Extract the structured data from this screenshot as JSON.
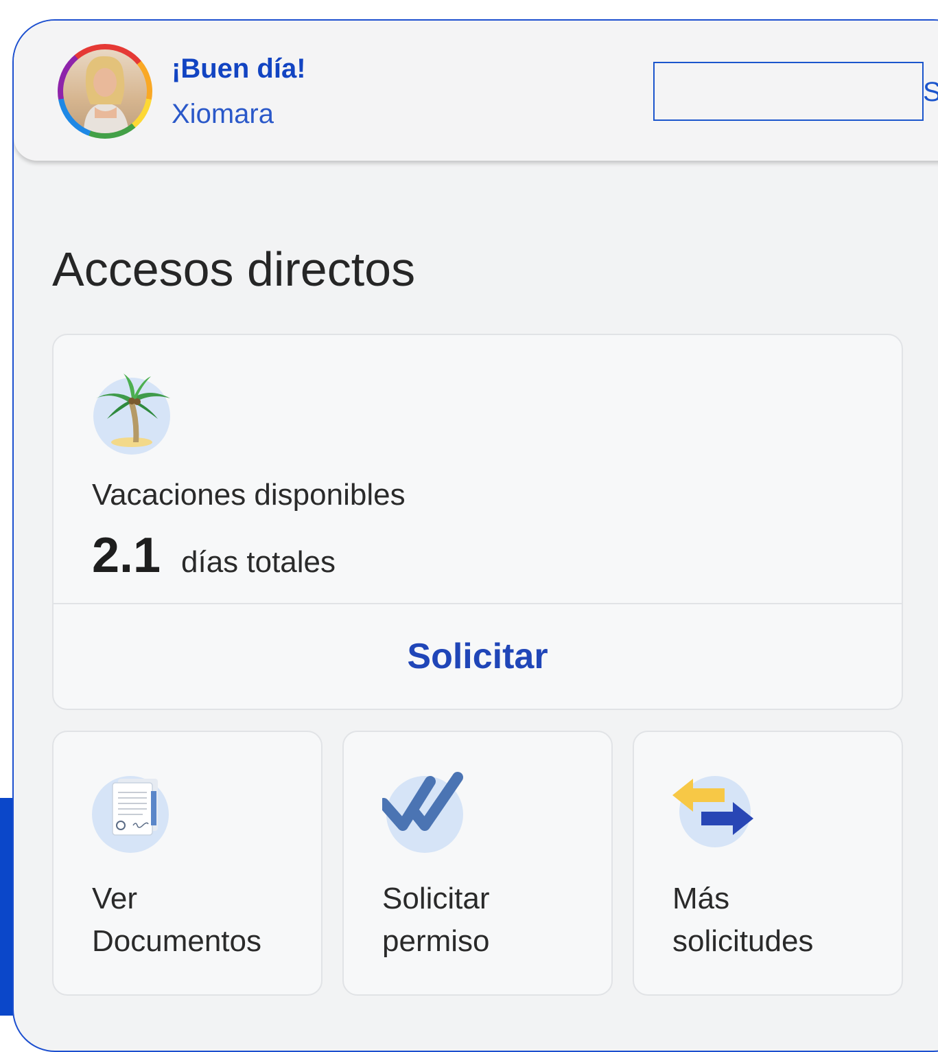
{
  "header": {
    "greeting": "¡Buen día!",
    "user_name": "Xiomara",
    "edge_text": "S"
  },
  "section": {
    "title": "Accesos directos"
  },
  "vacation": {
    "label": "Vacaciones disponibles",
    "value": "2.1",
    "unit": "días totales",
    "action": "Solicitar"
  },
  "shortcuts": [
    {
      "label_line1": "Ver",
      "label_line2": "Documentos",
      "icon": "document-icon"
    },
    {
      "label_line1": "Solicitar",
      "label_line2": "permiso",
      "icon": "double-check-icon"
    },
    {
      "label_line1": "Más",
      "label_line2": "solicitudes",
      "icon": "swap-arrows-icon"
    }
  ],
  "colors": {
    "brand_blue": "#1244c2",
    "action_blue": "#2046b8",
    "card_bg": "#f7f8f9",
    "page_bg": "#f2f3f4"
  }
}
